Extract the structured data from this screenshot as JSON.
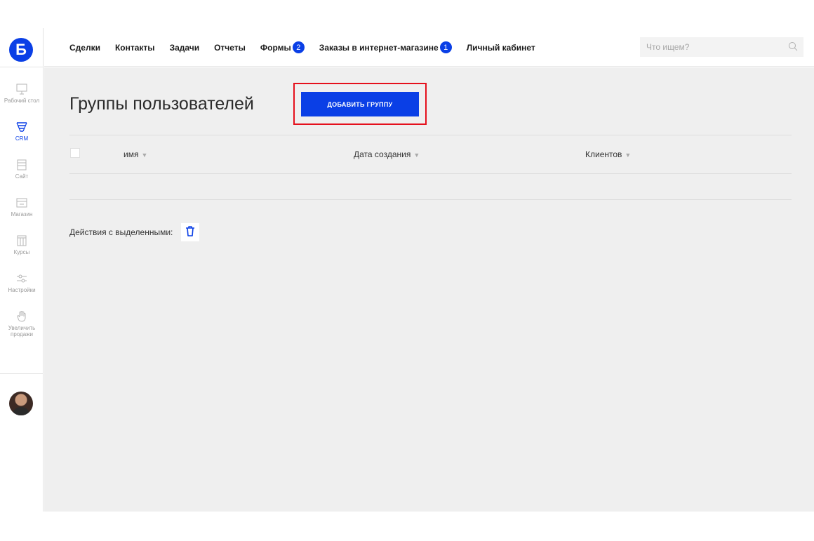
{
  "brand": {
    "logo_letter": "Б",
    "color": "#0a3fe6"
  },
  "sidebar": {
    "items": [
      {
        "label": "Рабочий стол",
        "icon": "monitor-icon",
        "active": false
      },
      {
        "label": "CRM",
        "icon": "funnel-icon",
        "active": true
      },
      {
        "label": "Сайт",
        "icon": "site-icon",
        "active": false
      },
      {
        "label": "Магазин",
        "icon": "shop-icon",
        "active": false
      },
      {
        "label": "Курсы",
        "icon": "courses-icon",
        "active": false
      },
      {
        "label": "Настройки",
        "icon": "settings-sliders-icon",
        "active": false
      },
      {
        "label": "Увеличить продажи",
        "icon": "hand-icon",
        "active": false
      }
    ]
  },
  "topnav": {
    "items": [
      {
        "label": "Сделки"
      },
      {
        "label": "Контакты"
      },
      {
        "label": "Задачи"
      },
      {
        "label": "Отчеты"
      },
      {
        "label": "Формы",
        "badge": "2"
      },
      {
        "label": "Заказы в интернет-магазине",
        "badge": "1"
      },
      {
        "label": "Личный кабинет"
      }
    ],
    "search": {
      "placeholder": "Что ищем?",
      "value": ""
    }
  },
  "page": {
    "title": "Группы пользователей",
    "add_button": "ДОБАВИТЬ ГРУППУ",
    "columns": [
      {
        "label": "имя"
      },
      {
        "label": "Дата создания"
      },
      {
        "label": "Клиентов"
      }
    ],
    "rows": [],
    "actions_label": "Действия с выделенными:"
  },
  "colors": {
    "accent": "#0a3fe6",
    "highlight": "#e5101c",
    "background": "#efefef"
  }
}
